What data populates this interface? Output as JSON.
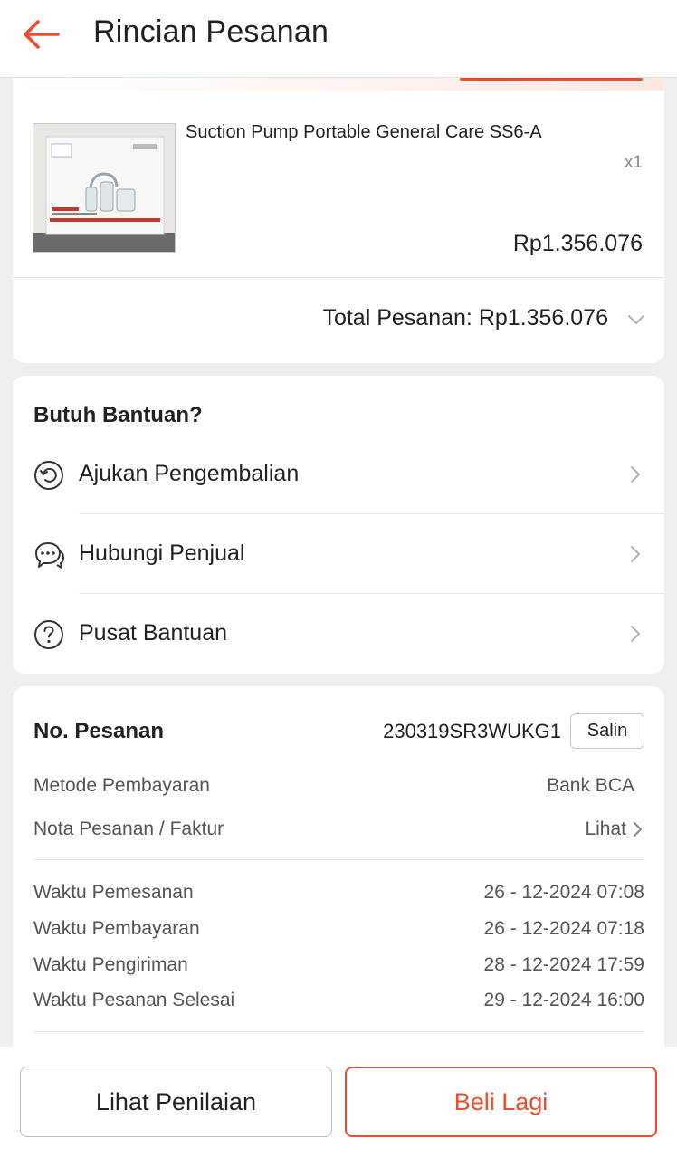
{
  "header": {
    "title": "Rincian Pesanan"
  },
  "product": {
    "name": "Suction Pump Portable General Care SS6-A",
    "quantity": "x1",
    "price": "Rp1.356.076",
    "total_label": "Total Pesanan:",
    "total_value": "Rp1.356.076"
  },
  "help": {
    "title": "Butuh Bantuan?",
    "items": [
      {
        "label": "Ajukan Pengembalian",
        "icon": "return-icon"
      },
      {
        "label": "Hubungi Penjual",
        "icon": "chat-icon"
      },
      {
        "label": "Pusat Bantuan",
        "icon": "question-icon"
      }
    ]
  },
  "order": {
    "number_label": "No. Pesanan",
    "number_value": "230319SR3WUKG1",
    "copy_label": "Salin",
    "payment_method_label": "Metode Pembayaran",
    "payment_method_value": "Bank BCA",
    "invoice_label": "Nota Pesanan / Faktur",
    "invoice_link": "Lihat",
    "times": [
      {
        "label": "Waktu Pemesanan",
        "value": "26 - 12-2024 07:08"
      },
      {
        "label": "Waktu Pembayaran",
        "value": "26 - 12-2024 07:18"
      },
      {
        "label": "Waktu Pengiriman",
        "value": "28 - 12-2024 17:59"
      },
      {
        "label": "Waktu Pesanan Selesai",
        "value": "29 - 12-2024 16:00"
      }
    ]
  },
  "footer": {
    "review_label": "Lihat Penilaian",
    "buy_again_label": "Beli Lagi"
  },
  "colors": {
    "accent": "#ee4d2d",
    "background": "#efefef",
    "text": "#222222",
    "muted": "#555555"
  }
}
